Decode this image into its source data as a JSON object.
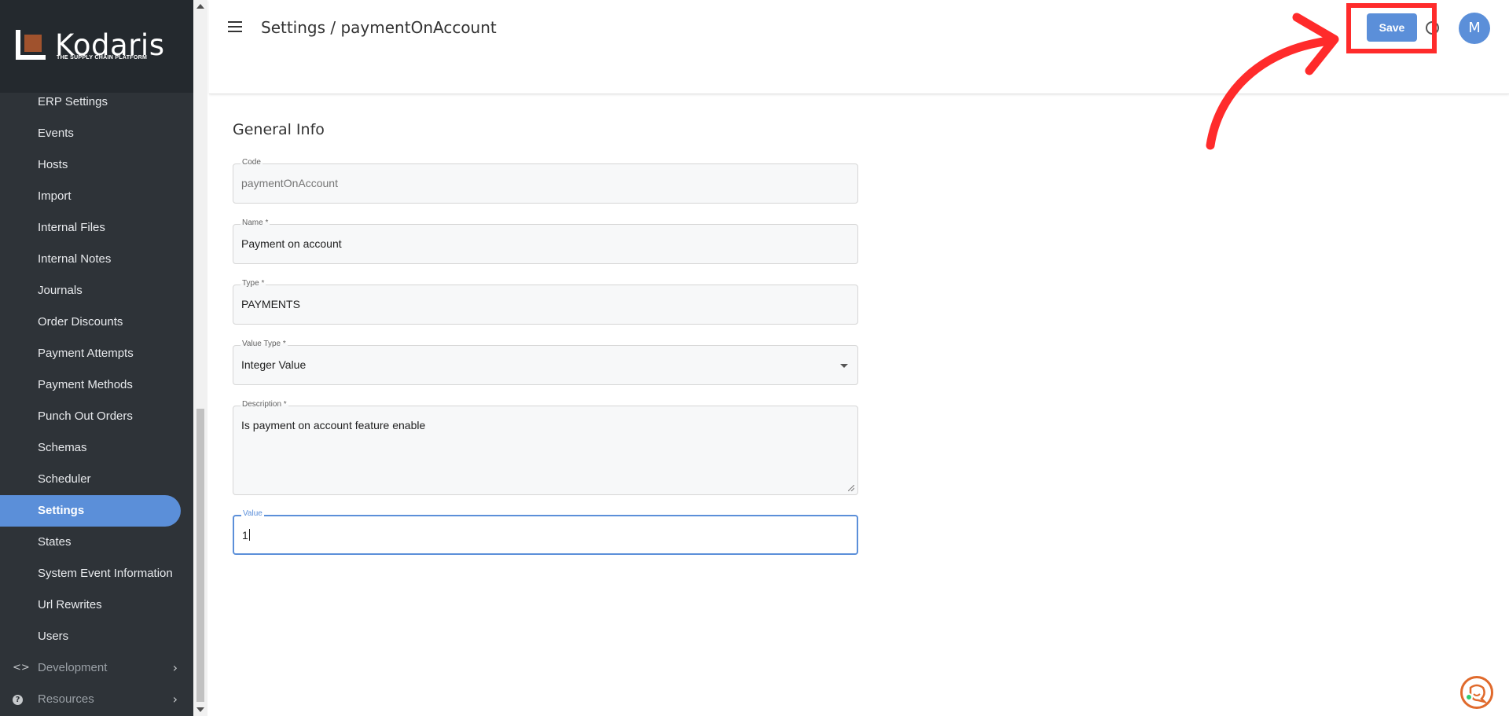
{
  "brand": {
    "name": "Kodaris",
    "tagline": "THE SUPPLY CHAIN PLATFORM",
    "accent_color": "#5b8fd9",
    "logo_color": "#a0522d"
  },
  "sidebar": {
    "items": [
      {
        "label": "ERP Settings",
        "name": "sidebar-item-erp-settings"
      },
      {
        "label": "Events",
        "name": "sidebar-item-events"
      },
      {
        "label": "Hosts",
        "name": "sidebar-item-hosts"
      },
      {
        "label": "Import",
        "name": "sidebar-item-import"
      },
      {
        "label": "Internal Files",
        "name": "sidebar-item-internal-files"
      },
      {
        "label": "Internal Notes",
        "name": "sidebar-item-internal-notes"
      },
      {
        "label": "Journals",
        "name": "sidebar-item-journals"
      },
      {
        "label": "Order Discounts",
        "name": "sidebar-item-order-discounts"
      },
      {
        "label": "Payment Attempts",
        "name": "sidebar-item-payment-attempts"
      },
      {
        "label": "Payment Methods",
        "name": "sidebar-item-payment-methods"
      },
      {
        "label": "Punch Out Orders",
        "name": "sidebar-item-punch-out-orders"
      },
      {
        "label": "Schemas",
        "name": "sidebar-item-schemas"
      },
      {
        "label": "Scheduler",
        "name": "sidebar-item-scheduler"
      },
      {
        "label": "Settings",
        "name": "sidebar-item-settings",
        "active": true
      },
      {
        "label": "States",
        "name": "sidebar-item-states"
      },
      {
        "label": "System Event Information",
        "name": "sidebar-item-system-event-information"
      },
      {
        "label": "Url Rewrites",
        "name": "sidebar-item-url-rewrites"
      },
      {
        "label": "Users",
        "name": "sidebar-item-users"
      }
    ],
    "groups": [
      {
        "label": "Development",
        "icon": "code-icon"
      },
      {
        "label": "Resources",
        "icon": "help-icon"
      }
    ]
  },
  "header": {
    "title": "Settings / paymentOnAccount",
    "save_label": "Save",
    "avatar_initial": "M"
  },
  "form": {
    "section_title": "General Info",
    "code": {
      "label": "Code",
      "value": "paymentOnAccount"
    },
    "name": {
      "label": "Name *",
      "value": "Payment on account"
    },
    "type": {
      "label": "Type *",
      "value": "PAYMENTS"
    },
    "value_type": {
      "label": "Value Type *",
      "value": "Integer Value"
    },
    "description": {
      "label": "Description *",
      "value": "Is payment on account feature enable"
    },
    "value": {
      "label": "Value",
      "value": "1"
    }
  },
  "annotation": {
    "highlight_color": "#ff2b2b"
  }
}
